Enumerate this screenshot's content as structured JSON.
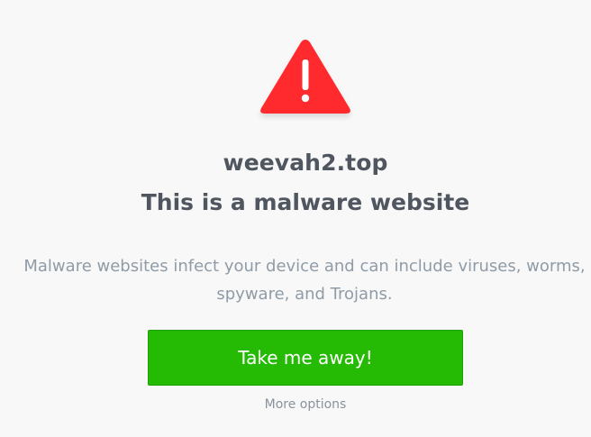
{
  "warning": {
    "icon": "warning-triangle-icon",
    "color": "#ff2b2f"
  },
  "site": {
    "domain": "weevah2.top"
  },
  "heading": {
    "title": "This is a malware website"
  },
  "body": {
    "description": "Malware websites infect your device and can include viruses, worms, spyware, and Trojans."
  },
  "actions": {
    "primary_label": "Take me away!",
    "primary_color": "#25bb05",
    "secondary_label": "More options"
  }
}
